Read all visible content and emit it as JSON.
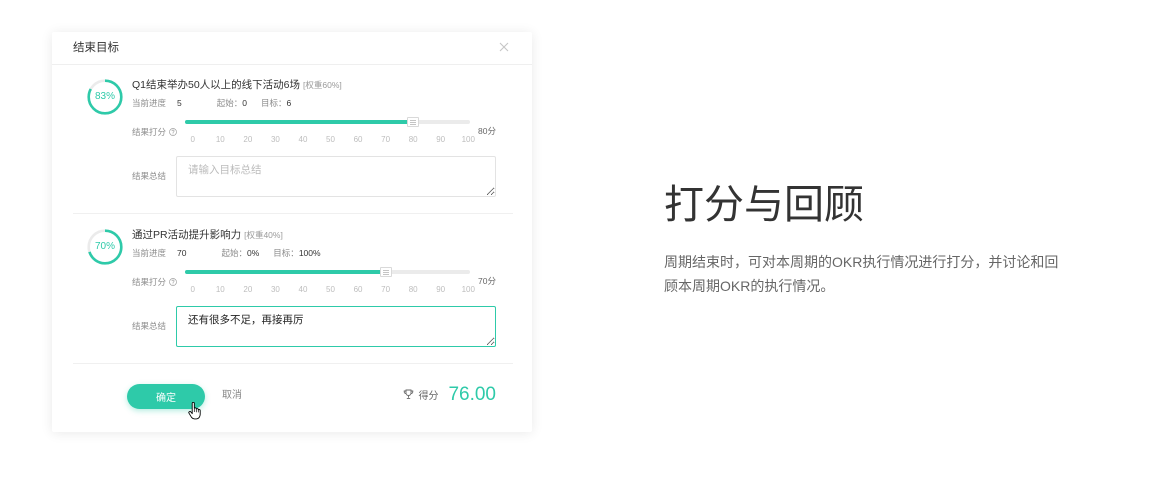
{
  "modal": {
    "title": "结束目标",
    "goals": [
      {
        "progress": 83,
        "progress_label": "83%",
        "title": "Q1结束举办50人以上的线下活动6场",
        "weight": "[权重60%]",
        "current_label": "当前进度",
        "current": "5",
        "start_label": "起始：",
        "start": "0",
        "target_label": "目标：",
        "target": "6",
        "score_label": "结果打分",
        "score": 80,
        "score_text": "80分",
        "summary_label": "结果总结",
        "summary_placeholder": "请输入目标总结"
      },
      {
        "progress": 70,
        "progress_label": "70%",
        "title": "通过PR活动提升影响力",
        "weight": "[权重40%]",
        "current_label": "当前进度",
        "current": "70",
        "start_label": "起始：",
        "start": "0%",
        "target_label": "目标：",
        "target": "100%",
        "score_label": "结果打分",
        "score": 70,
        "score_text": "70分",
        "summary_label": "结果总结",
        "summary_value": "还有很多不足，再接再厉"
      }
    ],
    "slider_ticks": [
      "0",
      "10",
      "20",
      "30",
      "40",
      "50",
      "60",
      "70",
      "80",
      "90",
      "100"
    ],
    "footer": {
      "confirm_label": "确定",
      "cancel_label": "取消",
      "total_label": "得分",
      "total_value": "76.00"
    }
  },
  "feature": {
    "heading": "打分与回顾",
    "description": "周期结束时，可对本周期的OKR执行情况进行打分，并讨论和回顾本周期OKR的执行情况。"
  },
  "icons": {
    "close": "close-icon",
    "help": "help-icon",
    "trophy": "trophy-icon",
    "cursor": "hand-cursor-icon"
  },
  "colors": {
    "accent": "#2ecaa9",
    "text": "#333333",
    "muted": "#999999"
  }
}
